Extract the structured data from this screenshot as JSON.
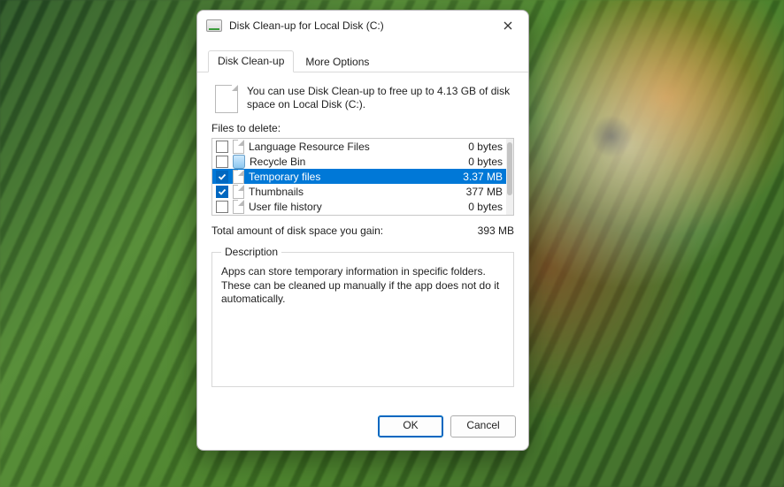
{
  "window": {
    "title": "Disk Clean-up for Local Disk  (C:)"
  },
  "tabs": {
    "cleanup": "Disk Clean-up",
    "more": "More Options"
  },
  "intro": {
    "text": "You can use Disk Clean-up to free up to 4.13 GB of disk space on Local Disk  (C:)."
  },
  "files_label": "Files to delete:",
  "list": [
    {
      "checked": false,
      "icon": "file",
      "name": "Language Resource Files",
      "size": "0 bytes",
      "selected": false
    },
    {
      "checked": false,
      "icon": "recycle",
      "name": "Recycle Bin",
      "size": "0 bytes",
      "selected": false
    },
    {
      "checked": true,
      "icon": "file",
      "name": "Temporary files",
      "size": "3.37 MB",
      "selected": true
    },
    {
      "checked": true,
      "icon": "file",
      "name": "Thumbnails",
      "size": "377 MB",
      "selected": false
    },
    {
      "checked": false,
      "icon": "file",
      "name": "User file history",
      "size": "0 bytes",
      "selected": false
    }
  ],
  "totals": {
    "label": "Total amount of disk space you gain:",
    "value": "393 MB"
  },
  "description": {
    "legend": "Description",
    "text": "Apps can store temporary information in specific folders. These can be cleaned up manually if the app does not do it automatically."
  },
  "buttons": {
    "ok": "OK",
    "cancel": "Cancel"
  }
}
